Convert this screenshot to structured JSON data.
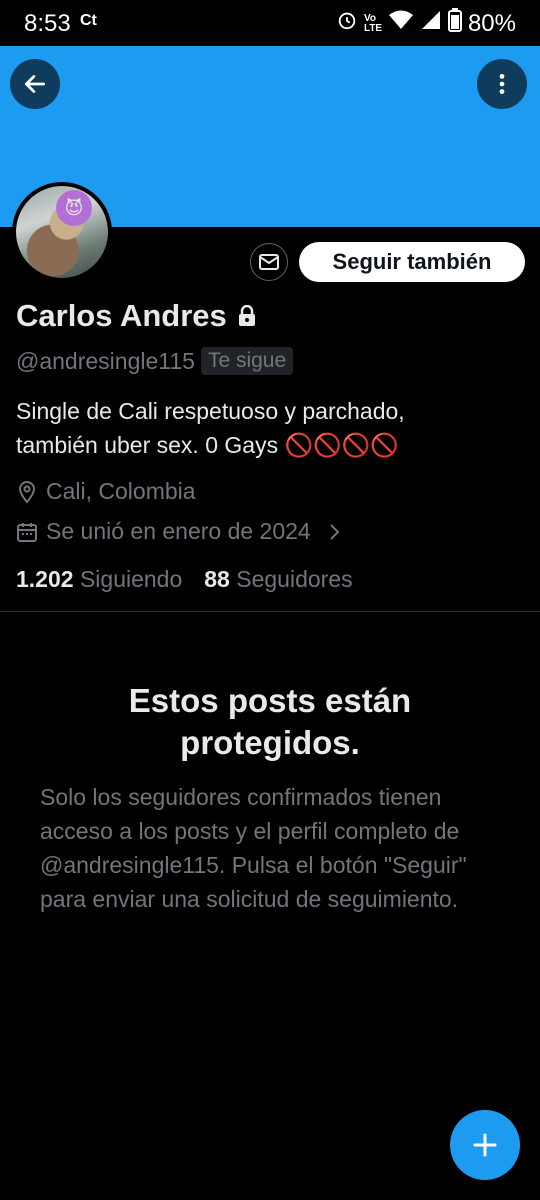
{
  "status_bar": {
    "time": "8:53",
    "carrier_icon": "Ct",
    "icons": [
      "alarm-icon",
      "volte-icon",
      "wifi-icon",
      "signal-icon",
      "battery-icon"
    ],
    "volte_label": "Vo LTE",
    "battery": "80%"
  },
  "colors": {
    "banner": "#1d9bf0",
    "accent": "#1d9bf0",
    "background": "#000000"
  },
  "profile": {
    "name": "Carlos Andres",
    "handle": "@andresingle115",
    "follows_you": "Te sigue",
    "bio_line1": "Single de Cali respetuoso y parchado,",
    "bio_line2": "también uber sex. 0 Gays 🚫🚫🚫🚫",
    "location": "Cali, Colombia",
    "joined": "Se unió en enero de 2024",
    "following_count": "1.202",
    "following_label": "Siguiendo",
    "followers_count": "88",
    "followers_label": "Seguidores"
  },
  "actions": {
    "follow_label": "Seguir también"
  },
  "protected": {
    "title": "Estos posts están protegidos.",
    "body": "Solo los seguidores confirmados tienen acceso a los posts y el perfil completo de @andresingle115. Pulsa el botón \"Seguir\" para enviar una solicitud de seguimiento."
  }
}
